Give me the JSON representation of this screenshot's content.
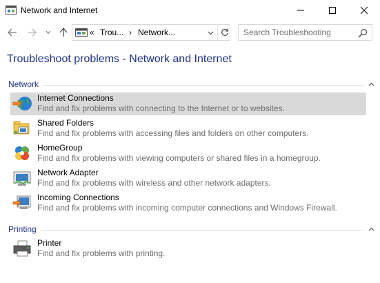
{
  "window": {
    "title": "Network and Internet",
    "icon": "control-panel-icon"
  },
  "nav": {
    "back_icon": "arrow-left-icon",
    "forward_icon": "arrow-right-icon",
    "recent_icon": "chevron-down-icon",
    "up_icon": "arrow-up-icon"
  },
  "address": {
    "prefix": "«",
    "crumbs": [
      "Trou...",
      "Network..."
    ],
    "separator": "›"
  },
  "search": {
    "placeholder": "Search Troubleshooting"
  },
  "page": {
    "title": "Troubleshoot problems - Network and Internet"
  },
  "groups": [
    {
      "label": "Network",
      "items": [
        {
          "title": "Internet Connections",
          "desc": "Find and fix problems with connecting to the Internet or to websites.",
          "icon": "globe-icon",
          "selected": true
        },
        {
          "title": "Shared Folders",
          "desc": "Find and fix problems with accessing files and folders on other computers.",
          "icon": "shared-folder-icon",
          "selected": false
        },
        {
          "title": "HomeGroup",
          "desc": "Find and fix problems with viewing computers or shared files in a homegroup.",
          "icon": "homegroup-icon",
          "selected": false
        },
        {
          "title": "Network Adapter",
          "desc": "Find and fix problems with wireless and other network adapters.",
          "icon": "network-adapter-icon",
          "selected": false
        },
        {
          "title": "Incoming Connections",
          "desc": "Find and fix problems with incoming computer connections and Windows Firewall.",
          "icon": "incoming-connections-icon",
          "selected": false
        }
      ]
    },
    {
      "label": "Printing",
      "items": [
        {
          "title": "Printer",
          "desc": "Find and fix problems with printing.",
          "icon": "printer-icon",
          "selected": false
        }
      ]
    }
  ]
}
